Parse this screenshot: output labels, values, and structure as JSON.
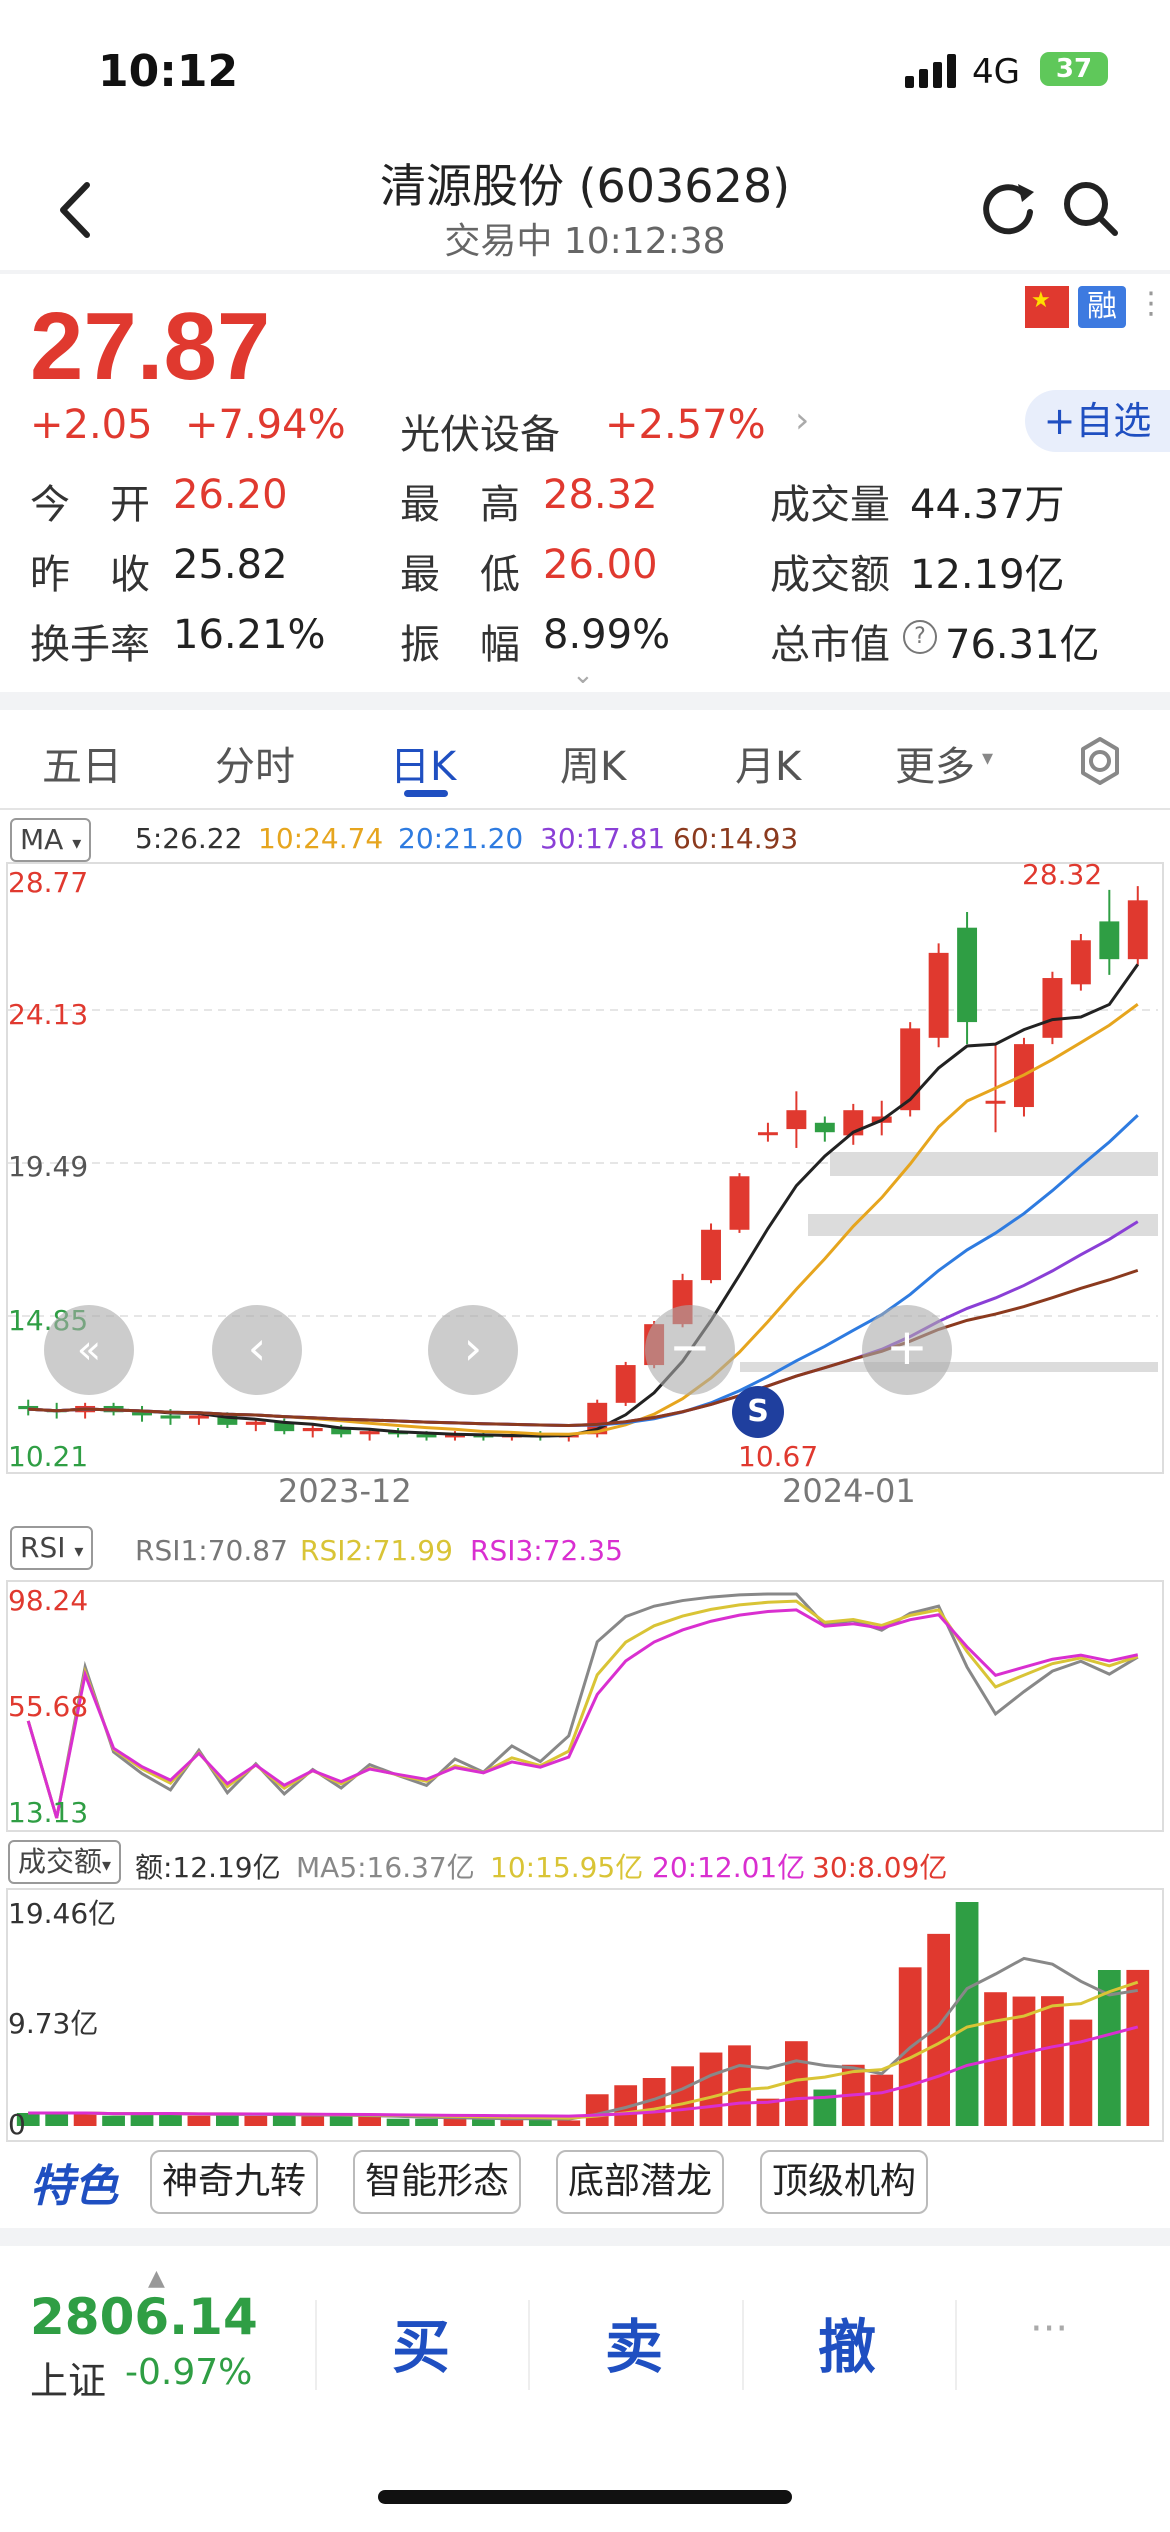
{
  "status_bar": {
    "time": "10:12",
    "network": "4G",
    "battery": "37"
  },
  "header": {
    "title": "清源股份 (603628)",
    "subtitle": "交易中 10:12:38"
  },
  "quote": {
    "price": "27.87",
    "change": "+2.05",
    "change_pct": "+7.94%",
    "sector": "光伏设备",
    "sector_pct": "+2.57%",
    "watch_label": "+自选",
    "badge_rong": "融",
    "open_label": "今　开",
    "open": "26.20",
    "prev_label": "昨　收",
    "prev": "25.82",
    "turnover_label": "换手率",
    "turnover": "16.21%",
    "high_label": "最　高",
    "high": "28.32",
    "low_label": "最　低",
    "low": "26.00",
    "amp_label": "振　幅",
    "amp": "8.99%",
    "vol_label": "成交量",
    "vol": "44.37万",
    "amt_label": "成交额",
    "amt": "12.19亿",
    "cap_label": "总市值",
    "cap": "76.31亿"
  },
  "tabs": [
    "五日",
    "分时",
    "日K",
    "周K",
    "月K",
    "更多"
  ],
  "colors": {
    "up": "#e0392f",
    "down": "#2f9e44",
    "accent": "#1f4fc1"
  },
  "ma": {
    "selector": "MA",
    "ma5": "5:26.22",
    "ma10": "10:24.74",
    "ma20": "20:21.20",
    "ma30": "30:17.81",
    "ma60": "60:14.93"
  },
  "kline": {
    "y_labels": [
      "28.77",
      "24.13",
      "19.49",
      "14.85",
      "10.21"
    ],
    "x_labels": [
      "2023-12",
      "2024-01"
    ],
    "high_mark": "28.32",
    "low_mark": "10.67"
  },
  "rsi": {
    "selector": "RSI",
    "rsi1": "RSI1:70.87",
    "rsi2": "RSI2:71.99",
    "rsi3": "RSI3:72.35",
    "y_labels": [
      "98.24",
      "55.68",
      "13.13"
    ]
  },
  "volume": {
    "selector": "成交额",
    "amt": "额:12.19亿",
    "ma5": "MA5:16.37亿",
    "ma10": "10:15.95亿",
    "ma20": "20:12.01亿",
    "ma30": "30:8.09亿",
    "y_labels": [
      "19.46亿",
      "9.73亿",
      "0"
    ]
  },
  "features": {
    "label": "特色",
    "items": [
      "神奇九转",
      "智能形态",
      "底部潜龙",
      "顶级机构"
    ]
  },
  "bottom": {
    "index_value": "2806.14",
    "index_name": "上证",
    "index_pct": "-0.97%",
    "buy": "买",
    "sell": "卖",
    "cancel": "撤"
  },
  "chart_data": {
    "type": "candlestick",
    "series": [
      {
        "name": "K",
        "ohlc": [
          [
            11.8,
            12.0,
            11.5,
            11.7
          ],
          [
            11.7,
            11.9,
            11.4,
            11.6
          ],
          [
            11.6,
            11.9,
            11.4,
            11.8
          ],
          [
            11.8,
            11.9,
            11.5,
            11.6
          ],
          [
            11.6,
            11.8,
            11.3,
            11.5
          ],
          [
            11.5,
            11.7,
            11.2,
            11.4
          ],
          [
            11.4,
            11.6,
            11.2,
            11.5
          ],
          [
            11.5,
            11.6,
            11.1,
            11.2
          ],
          [
            11.2,
            11.4,
            11.0,
            11.3
          ],
          [
            11.3,
            11.4,
            10.9,
            11.0
          ],
          [
            11.0,
            11.2,
            10.8,
            11.1
          ],
          [
            11.1,
            11.2,
            10.8,
            10.9
          ],
          [
            10.9,
            11.1,
            10.7,
            11.0
          ],
          [
            11.0,
            11.1,
            10.8,
            10.9
          ],
          [
            10.9,
            11.0,
            10.7,
            10.8
          ],
          [
            10.8,
            11.0,
            10.7,
            10.9
          ],
          [
            10.9,
            11.0,
            10.7,
            10.8
          ],
          [
            10.8,
            11.0,
            10.7,
            10.9
          ],
          [
            10.9,
            11.0,
            10.7,
            10.8
          ],
          [
            10.8,
            10.9,
            10.67,
            10.9
          ],
          [
            10.9,
            12.0,
            10.8,
            11.9
          ],
          [
            11.9,
            13.2,
            11.8,
            13.1
          ],
          [
            13.1,
            14.5,
            13.0,
            14.4
          ],
          [
            14.4,
            16.0,
            14.3,
            15.8
          ],
          [
            15.8,
            17.6,
            15.7,
            17.4
          ],
          [
            17.4,
            19.2,
            17.3,
            19.1
          ],
          [
            20.5,
            20.8,
            20.2,
            20.5
          ],
          [
            20.6,
            21.8,
            20.0,
            21.2
          ],
          [
            20.8,
            21.0,
            20.2,
            20.5
          ],
          [
            20.4,
            21.4,
            20.1,
            21.2
          ],
          [
            20.8,
            21.5,
            20.4,
            21.0
          ],
          [
            21.2,
            24.0,
            21.0,
            23.8
          ],
          [
            23.5,
            26.5,
            23.2,
            26.2
          ],
          [
            27.0,
            27.5,
            23.3,
            24.0
          ],
          [
            21.5,
            23.3,
            20.5,
            21.5
          ],
          [
            21.3,
            23.5,
            21.0,
            23.3
          ],
          [
            23.5,
            25.6,
            23.3,
            25.4
          ],
          [
            25.2,
            26.8,
            25.0,
            26.6
          ],
          [
            27.2,
            28.2,
            25.5,
            26.0
          ],
          [
            26.0,
            28.32,
            25.8,
            27.87
          ]
        ]
      }
    ],
    "x_labels": [
      "2023-12",
      "2024-01"
    ],
    "ylim": [
      10.21,
      28.77
    ]
  }
}
